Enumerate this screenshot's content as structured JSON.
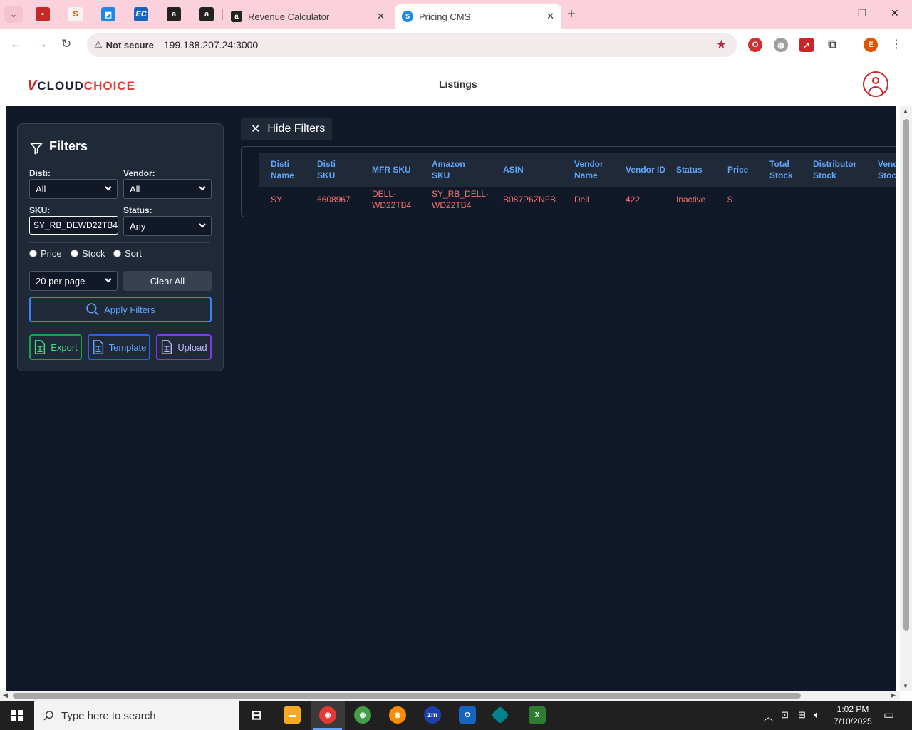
{
  "browser": {
    "tabs": [
      {
        "label": "Revenue Calculator"
      },
      {
        "label": "Pricing CMS"
      }
    ],
    "not_secure": "Not secure",
    "url": "199.188.207.24:3000",
    "profile_initial": "E"
  },
  "header": {
    "logo_v": "V",
    "logo_cloud": "CLOUD",
    "logo_choice": "CHOICE",
    "nav_title": "Listings"
  },
  "filters": {
    "title": "Filters",
    "disti_label": "Disti:",
    "disti_value": "All",
    "vendor_label": "Vendor:",
    "vendor_value": "All",
    "sku_label": "SKU:",
    "sku_value": "SY_RB_DEWD22TB4",
    "status_label": "Status:",
    "status_value": "Any",
    "radios": [
      "Price",
      "Stock",
      "Sort"
    ],
    "per_page": "20 per page",
    "clear_all": "Clear All",
    "apply": "Apply Filters",
    "export": "Export",
    "template": "Template",
    "upload": "Upload"
  },
  "hide_filters": "Hide Filters",
  "table": {
    "columns": [
      "Disti Name",
      "Disti SKU",
      "MFR SKU",
      "Amazon SKU",
      "ASIN",
      "Vendor Name",
      "Vendor ID",
      "Status",
      "Price",
      "Total Stock",
      "Distributor Stock",
      "Vendor Stock"
    ],
    "rows": [
      [
        "SY",
        "6608967",
        "DELL-WD22TB4",
        "SY_RB_DELL-WD22TB4",
        "B087P6ZNFB",
        "Dell",
        "422",
        "Inactive",
        "$",
        "",
        "",
        ""
      ]
    ]
  },
  "taskbar": {
    "search_placeholder": "Type here to search",
    "time": "1:02 PM",
    "date": "7/10/2025"
  }
}
